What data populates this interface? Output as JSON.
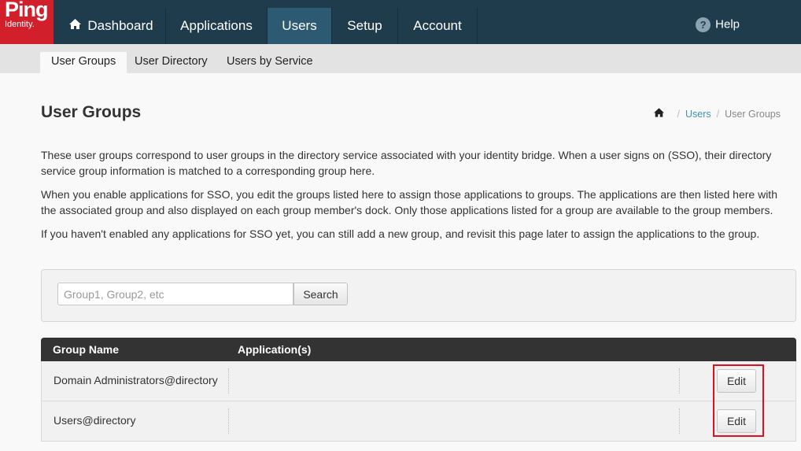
{
  "logo": {
    "brand": "Ping",
    "sub": "Identity."
  },
  "nav": {
    "items": [
      {
        "label": "Dashboard",
        "icon": "home-icon"
      },
      {
        "label": "Applications"
      },
      {
        "label": "Users"
      },
      {
        "label": "Setup"
      },
      {
        "label": "Account"
      }
    ],
    "active": "Users",
    "help_label": "Help"
  },
  "subnav": {
    "items": [
      {
        "label": "User Groups"
      },
      {
        "label": "User Directory"
      },
      {
        "label": "Users by Service"
      }
    ],
    "active": "User Groups"
  },
  "page": {
    "title": "User Groups",
    "breadcrumb": {
      "home_icon": "home-icon",
      "users": "Users",
      "current": "User Groups",
      "separator": "/"
    },
    "paragraphs": [
      "These user groups correspond to user groups in the directory service associated with your identity bridge. When a user signs on (SSO), their directory service group information is matched to a corresponding group here.",
      "When you enable applications for SSO, you edit the groups listed here to assign those applications to groups. The applications are then listed here with the associated group and also displayed on each group member's dock. Only those applications listed for a group are available to the group members.",
      "If you haven't enabled any applications for SSO yet, you can still add a new group, and revisit this page later to assign the applications to the group."
    ]
  },
  "search": {
    "placeholder": "Group1, Group2, etc",
    "value": "",
    "button_label": "Search"
  },
  "table": {
    "headers": {
      "group_name": "Group Name",
      "applications": "Application(s)"
    },
    "rows": [
      {
        "group_name": "Domain Administrators@directory",
        "applications": "",
        "action": "Edit"
      },
      {
        "group_name": "Users@directory",
        "applications": "",
        "action": "Edit"
      }
    ]
  },
  "colors": {
    "nav_bg": "#1f3c4d",
    "nav_active": "#2d5a73",
    "brand_red": "#d21f2c",
    "link": "#3a93b5",
    "highlight": "#e0101f"
  }
}
